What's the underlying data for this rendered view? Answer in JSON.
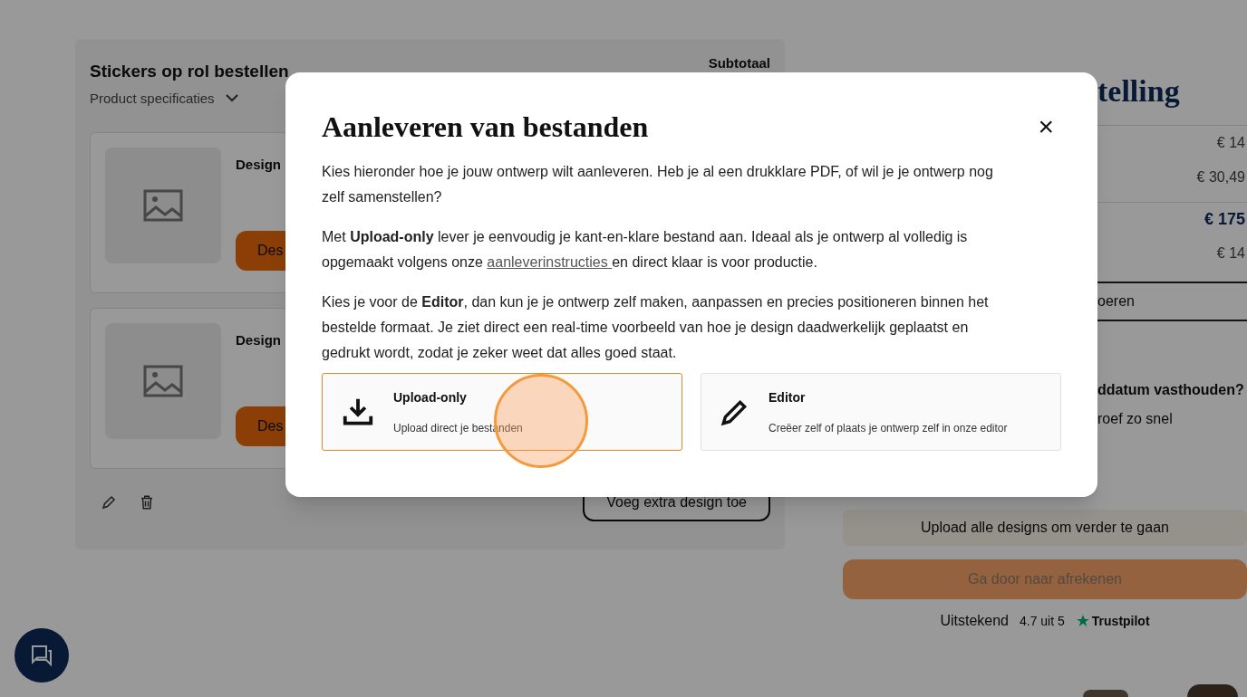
{
  "order_panel": {
    "title": "Stickers op rol bestellen",
    "specs_toggle": "Product specificaties",
    "subtotal_label": "Subtotaal",
    "designs": [
      {
        "label": "Design",
        "button": "Des"
      },
      {
        "label": "Design",
        "button": "Des"
      }
    ],
    "add_design_button": "Voeg extra design toe"
  },
  "summary": {
    "heading": "telling",
    "rows": [
      {
        "value": "€ 14",
        "kind": "plain"
      },
      {
        "value": "€ 30,49",
        "kind": "plain"
      },
      {
        "value": "€ 175",
        "kind": "total"
      },
      {
        "value": "€ 14",
        "kind": "plain"
      }
    ],
    "discount_toggle": "oeren",
    "question": "ddatum vasthouden?",
    "answer": "roef zo snel",
    "upload_notice": "Upload alle designs om verder te gaan",
    "checkout_button": {
      "label": "Ga door naar afrekenen",
      "disabled": true
    },
    "rating": {
      "label": "Uitstekend",
      "score": "4.7 uit 5",
      "brand": "Trustpilot"
    }
  },
  "modal": {
    "title": "Aanleveren van bestanden",
    "close": "×",
    "paragraphs": [
      {
        "text": "Kies hieronder hoe je jouw ontwerp wilt aanleveren. Heb je al een drukklare PDF, of wil je je ontwerp nog zelf samenstellen?"
      },
      {
        "text": "Met **Upload-only** lever je eenvoudig je kant-en-klare bestand aan. Ideaal als je ontwerp al volledig is opgemaakt volgens onze ",
        "link": "aanleverinstructies ",
        "after": "en direct klaar is voor productie."
      },
      {
        "text": "Kies je voor de **Editor**, dan kun je je ontwerp zelf maken, aanpassen en precies positioneren binnen het bestelde formaat. Je ziet direct een real-time voorbeeld van hoe je design daadwerkelijk geplaatst en gedrukt wordt, zodat je zeker weet dat alles goed staat."
      }
    ],
    "options": [
      {
        "kind": "upload",
        "title": "Upload-only",
        "description": "Upload direct je bestanden",
        "selected": true
      },
      {
        "kind": "editor",
        "title": "Editor",
        "description": "Creëer zelf of plaats je ontwerp zelf in onze editor",
        "selected": false
      }
    ]
  }
}
